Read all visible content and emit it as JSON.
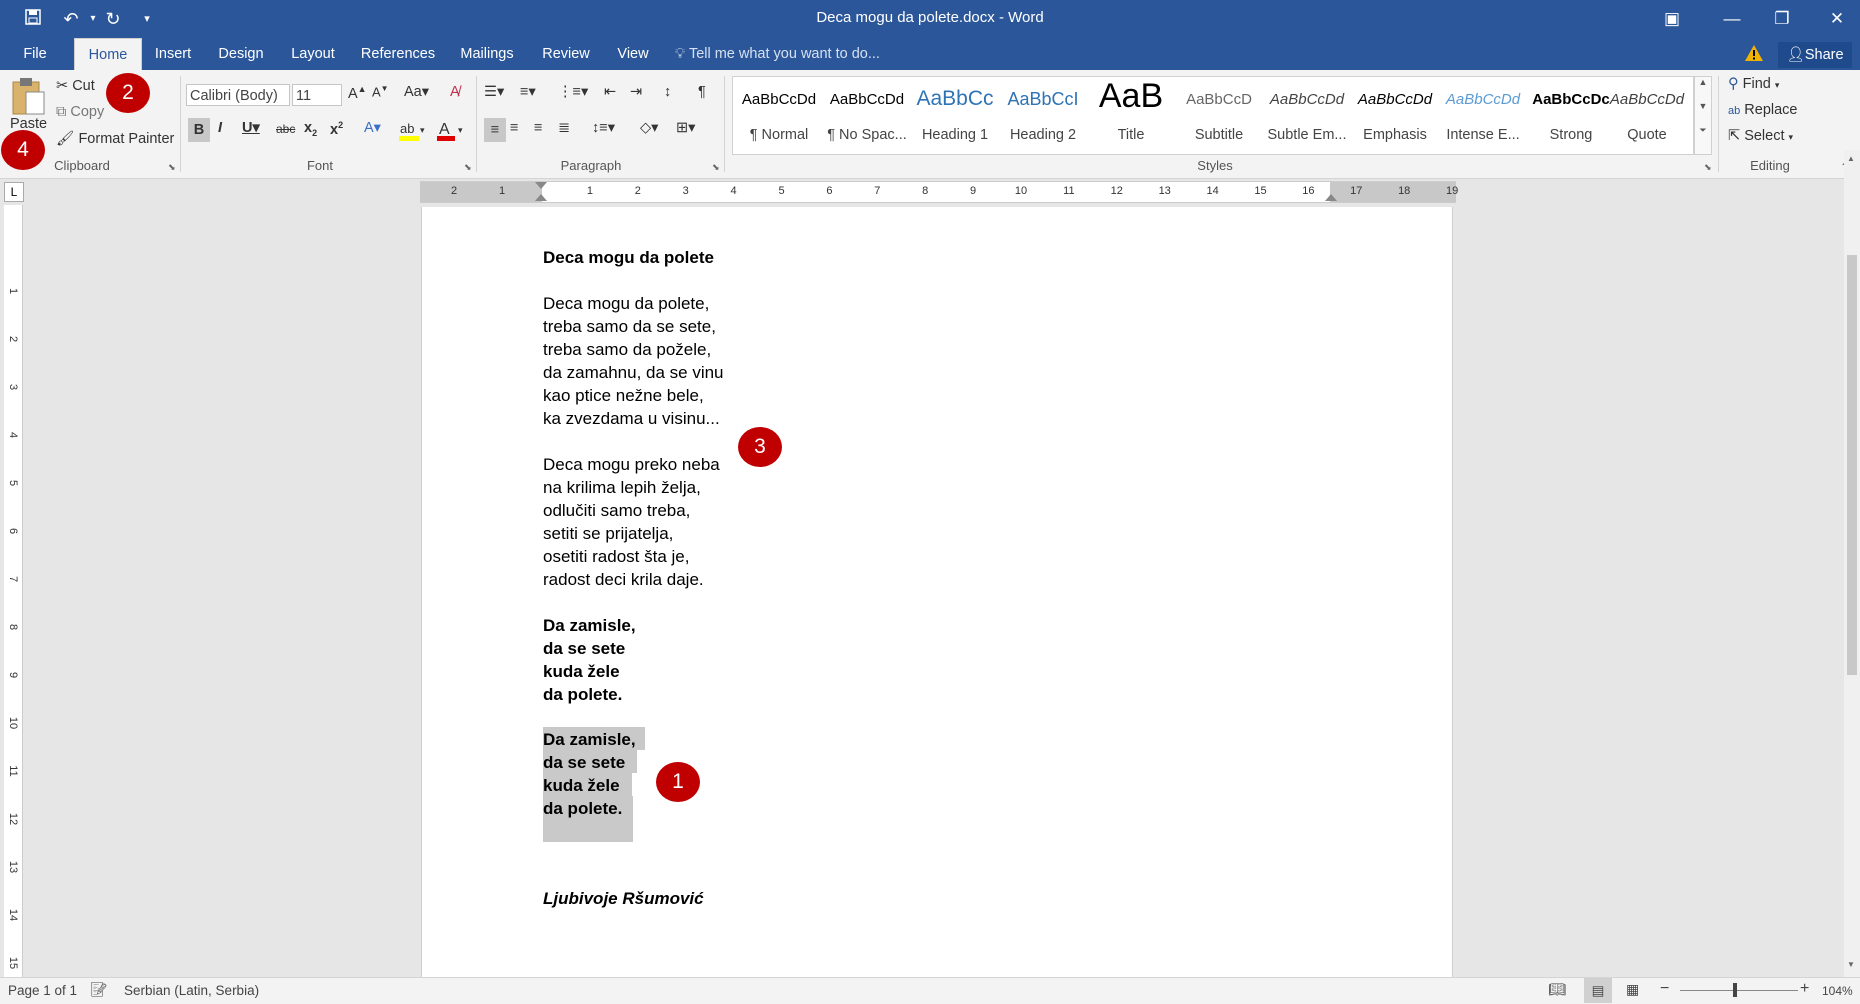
{
  "window": {
    "title": "Deca mogu da polete.docx - Word"
  },
  "tabs": [
    "File",
    "Home",
    "Insert",
    "Design",
    "Layout",
    "References",
    "Mailings",
    "Review",
    "View"
  ],
  "tell_me": "Tell me what you want to do...",
  "share_label": "Share",
  "clipboard": {
    "paste": "Paste",
    "cut": "Cut",
    "copy": "Copy",
    "format_painter": "Format Painter",
    "label": "Clipboard"
  },
  "font": {
    "name": "Calibri (Body)",
    "size": "11",
    "label": "Font"
  },
  "paragraph": {
    "label": "Paragraph"
  },
  "styles": {
    "label": "Styles",
    "items": [
      {
        "sample": "AaBbCcDd",
        "name": "¶ Normal"
      },
      {
        "sample": "AaBbCcDd",
        "name": "¶ No Spac..."
      },
      {
        "sample": "AaBbCc",
        "name": "Heading 1"
      },
      {
        "sample": "AaBbCcI",
        "name": "Heading 2"
      },
      {
        "sample": "AaB",
        "name": "Title"
      },
      {
        "sample": "AaBbCcD",
        "name": "Subtitle"
      },
      {
        "sample": "AaBbCcDd",
        "name": "Subtle Em..."
      },
      {
        "sample": "AaBbCcDd",
        "name": "Emphasis"
      },
      {
        "sample": "AaBbCcDd",
        "name": "Intense E..."
      },
      {
        "sample": "AaBbCcDc",
        "name": "Strong"
      },
      {
        "sample": "AaBbCcDd",
        "name": "Quote"
      }
    ]
  },
  "editing": {
    "find": "Find",
    "replace": "Replace",
    "select": "Select",
    "label": "Editing"
  },
  "callouts": [
    "1",
    "2",
    "3",
    "4"
  ],
  "ruler": {
    "h_left": [
      "2",
      "1"
    ],
    "h_marks": [
      "1",
      "2",
      "3",
      "4",
      "5",
      "6",
      "7",
      "8",
      "9",
      "10",
      "11",
      "12",
      "13",
      "14",
      "15",
      "16",
      "17",
      "18",
      "19"
    ],
    "v_marks": [
      "1",
      "2",
      "3",
      "4",
      "5",
      "6",
      "7",
      "8",
      "9",
      "10",
      "11",
      "12",
      "13",
      "14",
      "15"
    ],
    "tab_selector": "L"
  },
  "document": {
    "title": "Deca mogu da polete",
    "stanza1": [
      "Deca mogu da polete,",
      "treba samo da se sete,",
      "treba samo da požele,",
      "da zamahnu, da se vinu",
      "kao ptice nežne bele,",
      "ka zvezdama u visinu..."
    ],
    "stanza2": [
      "Deca mogu preko neba",
      "na krilima lepih želja,",
      "odlučiti samo treba,",
      "setiti se prijatelja,",
      "osetiti radost šta je,",
      "radost deci krila daje."
    ],
    "stanza3": [
      "Da zamisle,",
      "da se sete",
      "kuda žele",
      "da polete."
    ],
    "stanza4": [
      "Da zamisle,",
      "da se sete",
      "kuda žele",
      "da polete."
    ],
    "author": "Ljubivoje Ršumović"
  },
  "status": {
    "page": "Page 1 of 1",
    "language": "Serbian (Latin, Serbia)",
    "zoom": "104%"
  }
}
